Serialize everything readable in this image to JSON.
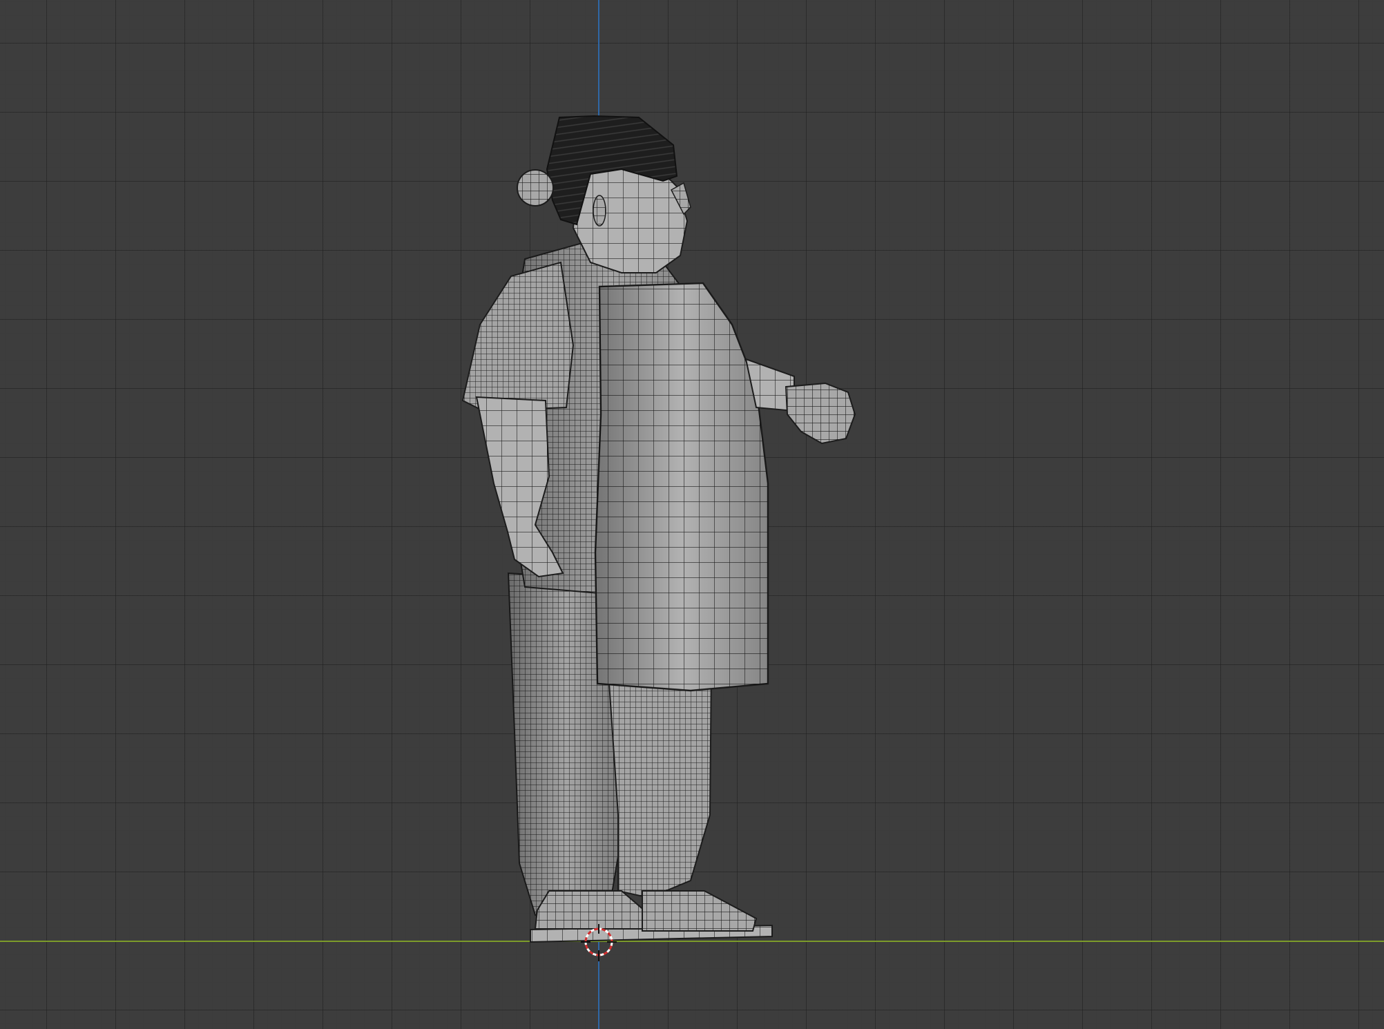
{
  "viewport": {
    "mode": "3d-viewport-wireframe-overlay",
    "background_color": "#3d3d3d",
    "grid_color": "#4a4a4a",
    "axis_z_color": "#2f6db3",
    "axis_y_color": "#7c9b2a",
    "mesh_color": "#a9a9a9",
    "wire_color": "#1c1c1c",
    "hair_color": "#1e1e1e"
  },
  "scene": {
    "object": "character-mesh",
    "cursor": "3d-cursor-icon"
  }
}
